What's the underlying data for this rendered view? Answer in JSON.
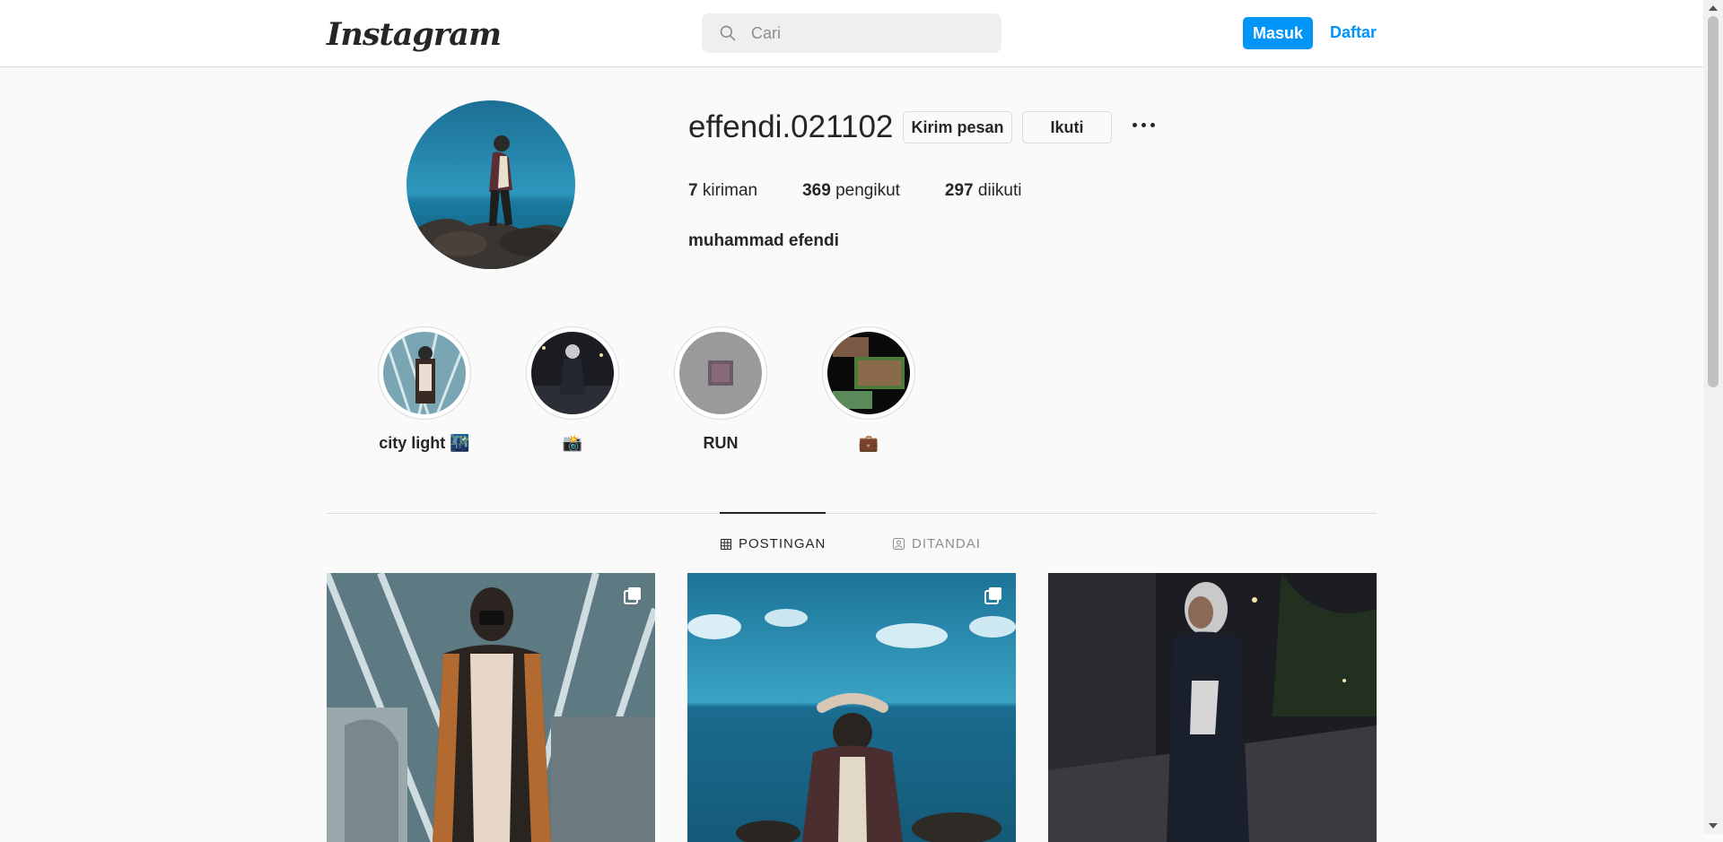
{
  "nav": {
    "logo": "Instagram",
    "search_placeholder": "Cari",
    "login_label": "Masuk",
    "signup_label": "Daftar"
  },
  "profile": {
    "username": "effendi.021102",
    "message_label": "Kirim pesan",
    "follow_label": "Ikuti",
    "posts_count": "7",
    "posts_label": "kiriman",
    "followers_count": "369",
    "followers_label": "pengikut",
    "following_count": "297",
    "following_label": "diikuti",
    "full_name": "muhammad efendi"
  },
  "highlights": [
    {
      "label": "city light 🌃"
    },
    {
      "label": "📸"
    },
    {
      "label": "RUN"
    },
    {
      "label": "💼"
    }
  ],
  "tabs": {
    "posts_label": "POSTINGAN",
    "tagged_label": "DITANDAI"
  },
  "colors": {
    "accent": "#0095f6",
    "background": "#fafafa",
    "border": "#dbdbdb"
  }
}
